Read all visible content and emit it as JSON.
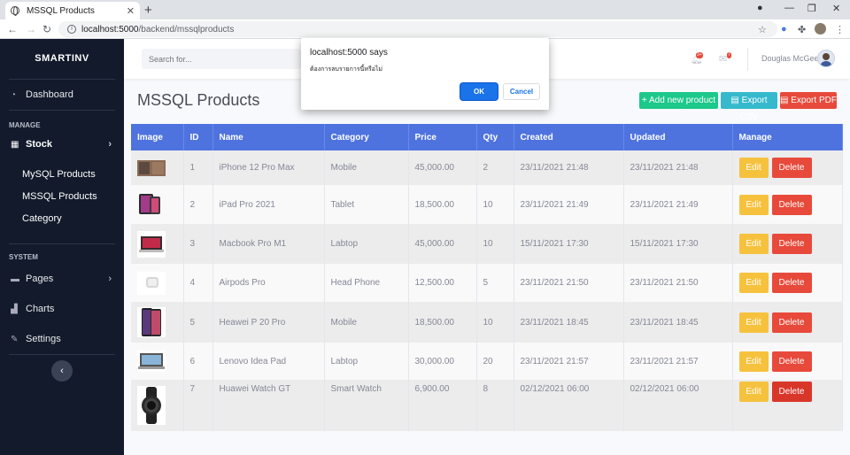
{
  "browser": {
    "tab_title": "MSSQL Products",
    "url_host": "localhost:5000",
    "url_path": "/backend/mssqlproducts"
  },
  "sidebar": {
    "brand": "SMARTINV",
    "dashboard": "Dashboard",
    "manage_heading": "MANAGE",
    "stock": "Stock",
    "sub_items": [
      "MySQL Products",
      "MSSQL Products",
      "Category"
    ],
    "system_heading": "SYSTEM",
    "pages": "Pages",
    "charts": "Charts",
    "settings": "Settings"
  },
  "topbar": {
    "search_placeholder": "Search for...",
    "alerts_badge": "3+",
    "messages_badge": "7",
    "username": "Douglas McGee"
  },
  "page": {
    "title": "MSSQL Products",
    "add_button": "Add new product",
    "csv_button": "Export CSV",
    "pdf_button": "Export PDF"
  },
  "table": {
    "headers": [
      "Image",
      "ID",
      "Name",
      "Category",
      "Price",
      "Qty",
      "Created",
      "Updated",
      "Manage"
    ],
    "edit_label": "Edit",
    "delete_label": "Delete",
    "rows": [
      {
        "id": "1",
        "name": "iPhone 12 Pro Max",
        "category": "Mobile",
        "price": "45,000.00",
        "qty": "2",
        "created": "23/11/2021 21:48",
        "updated": "23/11/2021 21:48"
      },
      {
        "id": "2",
        "name": "iPad Pro 2021",
        "category": "Tablet",
        "price": "18,500.00",
        "qty": "10",
        "created": "23/11/2021 21:49",
        "updated": "23/11/2021 21:49"
      },
      {
        "id": "3",
        "name": "Macbook Pro M1",
        "category": "Labtop",
        "price": "45,000.00",
        "qty": "10",
        "created": "15/11/2021 17:30",
        "updated": "15/11/2021 17:30"
      },
      {
        "id": "4",
        "name": "Airpods Pro",
        "category": "Head Phone",
        "price": "12,500.00",
        "qty": "5",
        "created": "23/11/2021 21:50",
        "updated": "23/11/2021 21:50"
      },
      {
        "id": "5",
        "name": "Heawei P 20 Pro",
        "category": "Mobile",
        "price": "18,500.00",
        "qty": "10",
        "created": "23/11/2021 18:45",
        "updated": "23/11/2021 18:45"
      },
      {
        "id": "6",
        "name": "Lenovo Idea Pad",
        "category": "Labtop",
        "price": "30,000.00",
        "qty": "20",
        "created": "23/11/2021 21:57",
        "updated": "23/11/2021 21:57"
      },
      {
        "id": "7",
        "name": "Huawei Watch GT",
        "category": "Smart Watch",
        "price": "6,900.00",
        "qty": "8",
        "created": "02/12/2021 06:00",
        "updated": "02/12/2021 06:00"
      }
    ]
  },
  "dialog": {
    "title": "localhost:5000 says",
    "message": "ต้องการลบรายการนี้หรือไม่",
    "ok": "OK",
    "cancel": "Cancel"
  },
  "colors": {
    "sidebar_bg": "#121a2b",
    "primary": "#4e73df",
    "success": "#1cc88a",
    "info": "#36b9cc",
    "danger": "#e74a3b",
    "warning": "#f6c23e"
  }
}
